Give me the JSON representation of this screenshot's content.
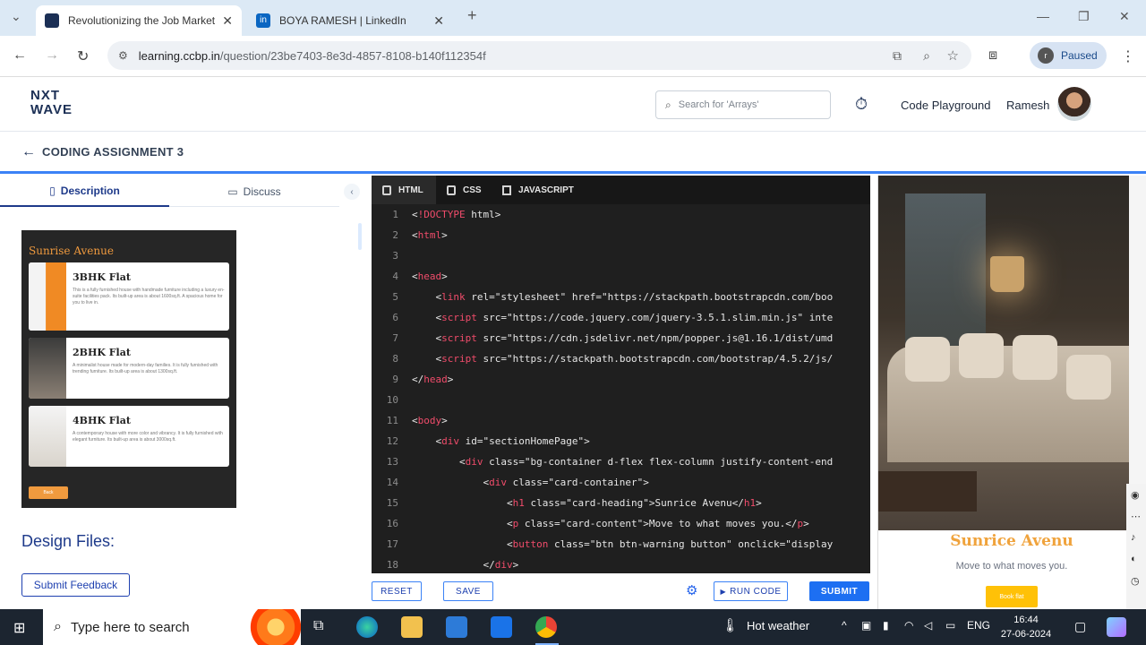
{
  "browser": {
    "tabs": [
      {
        "title": "Revolutionizing the Job Market",
        "active": true
      },
      {
        "title": "BOYA RAMESH | LinkedIn",
        "active": false
      }
    ],
    "new_tab": "+",
    "address_host": "learning.ccbp.in",
    "address_path": "/question/23be7403-8e3d-4857-8108-b140f112354f",
    "profile_initial": "r",
    "profile_status": "Paused"
  },
  "header": {
    "logo_line1": "NXT",
    "logo_line2": "WAVE",
    "search_placeholder": "Search for 'Arrays'",
    "code_playground": "Code Playground",
    "user_name": "Ramesh"
  },
  "assignment": {
    "title": "CODING ASSIGNMENT 3"
  },
  "left_panel": {
    "tabs": [
      "Description",
      "Discuss"
    ],
    "preview": {
      "title": "Sunrise Avenue",
      "cards": [
        {
          "heading": "3BHK Flat",
          "text": "This is a fully furnished house with handmade furniture including a luxury en-suite facilities pack. Its built-up area is about 1600sq.ft. A spacious home for you to live in."
        },
        {
          "heading": "2BHK Flat",
          "text": "A minimalist house made for modern-day families. It is fully furnished with trending furniture. Its built-up area is about 1300sq.ft."
        },
        {
          "heading": "4BHK Flat",
          "text": "A contemporary house with more color and vibrancy. It is fully furnished with elegant furniture. Its built-up area is about 3000sq.ft."
        }
      ],
      "back_button": "Back"
    },
    "design_files": "Design Files:",
    "feedback_button": "Submit Feedback"
  },
  "editor": {
    "tabs": [
      "HTML",
      "CSS",
      "JAVASCRIPT"
    ],
    "lines": [
      "<!DOCTYPE html>",
      "<html>",
      "",
      "<head>",
      "    <link rel=\"stylesheet\" href=\"https://stackpath.bootstrapcdn.com/boo",
      "    <script src=\"https://code.jquery.com/jquery-3.5.1.slim.min.js\" inte",
      "    <script src=\"https://cdn.jsdelivr.net/npm/popper.js@1.16.1/dist/umd",
      "    <script src=\"https://stackpath.bootstrapcdn.com/bootstrap/4.5.2/js/",
      "</head>",
      "",
      "<body>",
      "    <div id=\"sectionHomePage\">",
      "        <div class=\"bg-container d-flex flex-column justify-content-end",
      "            <div class=\"card-container\">",
      "                <h1 class=\"card-heading\">Sunrice Avenu</h1>",
      "                <p class=\"card-content\">Move to what moves you.</p>",
      "                <button class=\"btn btn-warning button\" onclick=\"display",
      "            </div>"
    ],
    "reset": "RESET",
    "save": "SAVE",
    "run": "RUN CODE",
    "submit": "SUBMIT"
  },
  "output": {
    "heading": "Sunrice Avenu",
    "content": "Move to what moves you.",
    "button": "Book flat"
  },
  "taskbar": {
    "search_placeholder": "Type here to search",
    "weather": "Hot weather",
    "language": "ENG",
    "time": "16:44",
    "date": "27-06-2024"
  }
}
